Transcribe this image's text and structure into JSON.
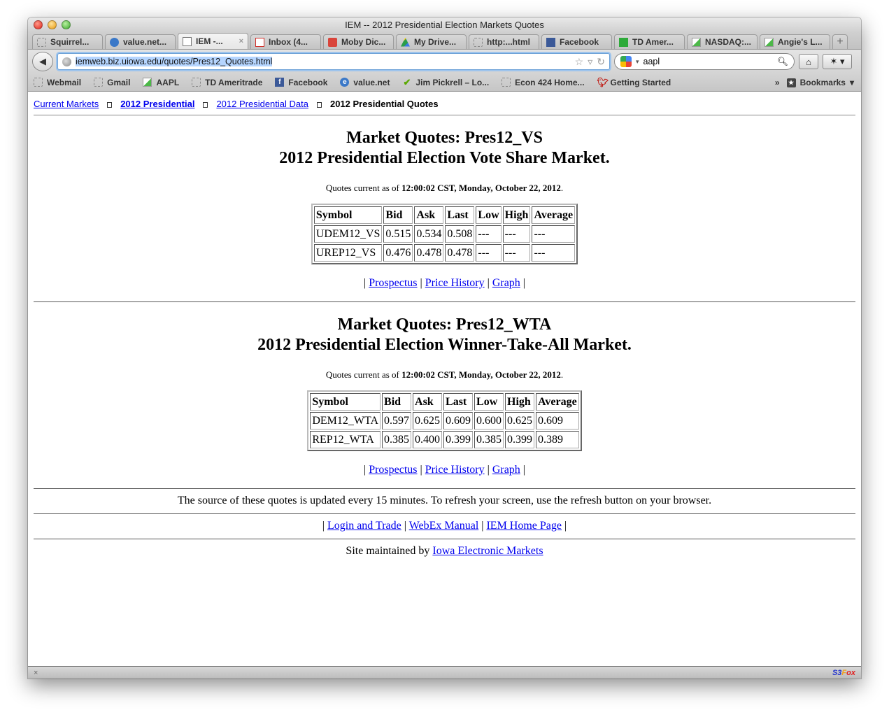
{
  "window": {
    "title": "IEM -- 2012 Presidential Election Markets Quotes"
  },
  "tabs": [
    {
      "label": "Squirrel...",
      "icon": "blank"
    },
    {
      "label": "value.net...",
      "icon": "ie"
    },
    {
      "label": "IEM -...",
      "icon": "doc",
      "active": true
    },
    {
      "label": "Inbox (4...",
      "icon": "gmail"
    },
    {
      "label": "Moby Dic...",
      "icon": "moby"
    },
    {
      "label": "My Drive...",
      "icon": "drive"
    },
    {
      "label": "http:...html",
      "icon": "blank"
    },
    {
      "label": "Facebook",
      "icon": "fb"
    },
    {
      "label": "TD Amer...",
      "icon": "td"
    },
    {
      "label": "NASDAQ:...",
      "icon": "chart"
    },
    {
      "label": "Angie's L...",
      "icon": "chart"
    }
  ],
  "tab_new": "+",
  "tab_close": "×",
  "navbar": {
    "url": "iemweb.biz.uiowa.edu/quotes/Pres12_Quotes.html",
    "search_value": "aapl"
  },
  "bookmarks": [
    {
      "label": "Webmail",
      "icon": "blank"
    },
    {
      "label": "Gmail",
      "icon": "blank"
    },
    {
      "label": "AAPL",
      "icon": "chart"
    },
    {
      "label": "TD Ameritrade",
      "icon": "blank"
    },
    {
      "label": "Facebook",
      "icon": "fb"
    },
    {
      "label": "value.net",
      "icon": "ie"
    },
    {
      "label": "Jim Pickrell – Lo...",
      "icon": "check"
    },
    {
      "label": "Econ 424 Home...",
      "icon": "blank"
    },
    {
      "label": "Getting Started",
      "icon": "bird"
    }
  ],
  "bookmarks_menu": "Bookmarks",
  "breadcrumb": {
    "current_markets": "Current Markets",
    "presidential": "2012 Presidential",
    "presidential_data": "2012 Presidential Data",
    "current": "2012 Presidential Quotes"
  },
  "markets": [
    {
      "title": "Market Quotes: Pres12_VS",
      "subtitle": "2012 Presidential Election Vote Share Market.",
      "asof_prefix": "Quotes current as of ",
      "asof_time": "12:00:02 CST, Monday, October 22, 2012",
      "columns": [
        "Symbol",
        "Bid",
        "Ask",
        "Last",
        "Low",
        "High",
        "Average"
      ],
      "rows": [
        [
          "UDEM12_VS",
          "0.515",
          "0.534",
          "0.508",
          "---",
          "---",
          "---"
        ],
        [
          "UREP12_VS",
          "0.476",
          "0.478",
          "0.478",
          "---",
          "---",
          "---"
        ]
      ],
      "links": [
        "Prospectus",
        "Price History",
        "Graph"
      ]
    },
    {
      "title": "Market Quotes: Pres12_WTA",
      "subtitle": "2012 Presidential Election Winner-Take-All Market.",
      "asof_prefix": "Quotes current as of ",
      "asof_time": "12:00:02 CST, Monday, October 22, 2012",
      "columns": [
        "Symbol",
        "Bid",
        "Ask",
        "Last",
        "Low",
        "High",
        "Average"
      ],
      "rows": [
        [
          "DEM12_WTA",
          "0.597",
          "0.625",
          "0.609",
          "0.600",
          "0.625",
          "0.609"
        ],
        [
          "REP12_WTA",
          "0.385",
          "0.400",
          "0.399",
          "0.385",
          "0.399",
          "0.389"
        ]
      ],
      "links": [
        "Prospectus",
        "Price History",
        "Graph"
      ]
    }
  ],
  "footer": {
    "refresh_note": "The source of these quotes is updated every 15 minutes. To refresh your screen, use the refresh button on your browser.",
    "links": [
      "Login and Trade",
      "WebEx Manual",
      "IEM Home Page"
    ],
    "maintained_prefix": "Site maintained by ",
    "maintained_link": "Iowa Electronic Markets"
  },
  "statusbar": {
    "close": "×",
    "addon": "S3Fox"
  }
}
